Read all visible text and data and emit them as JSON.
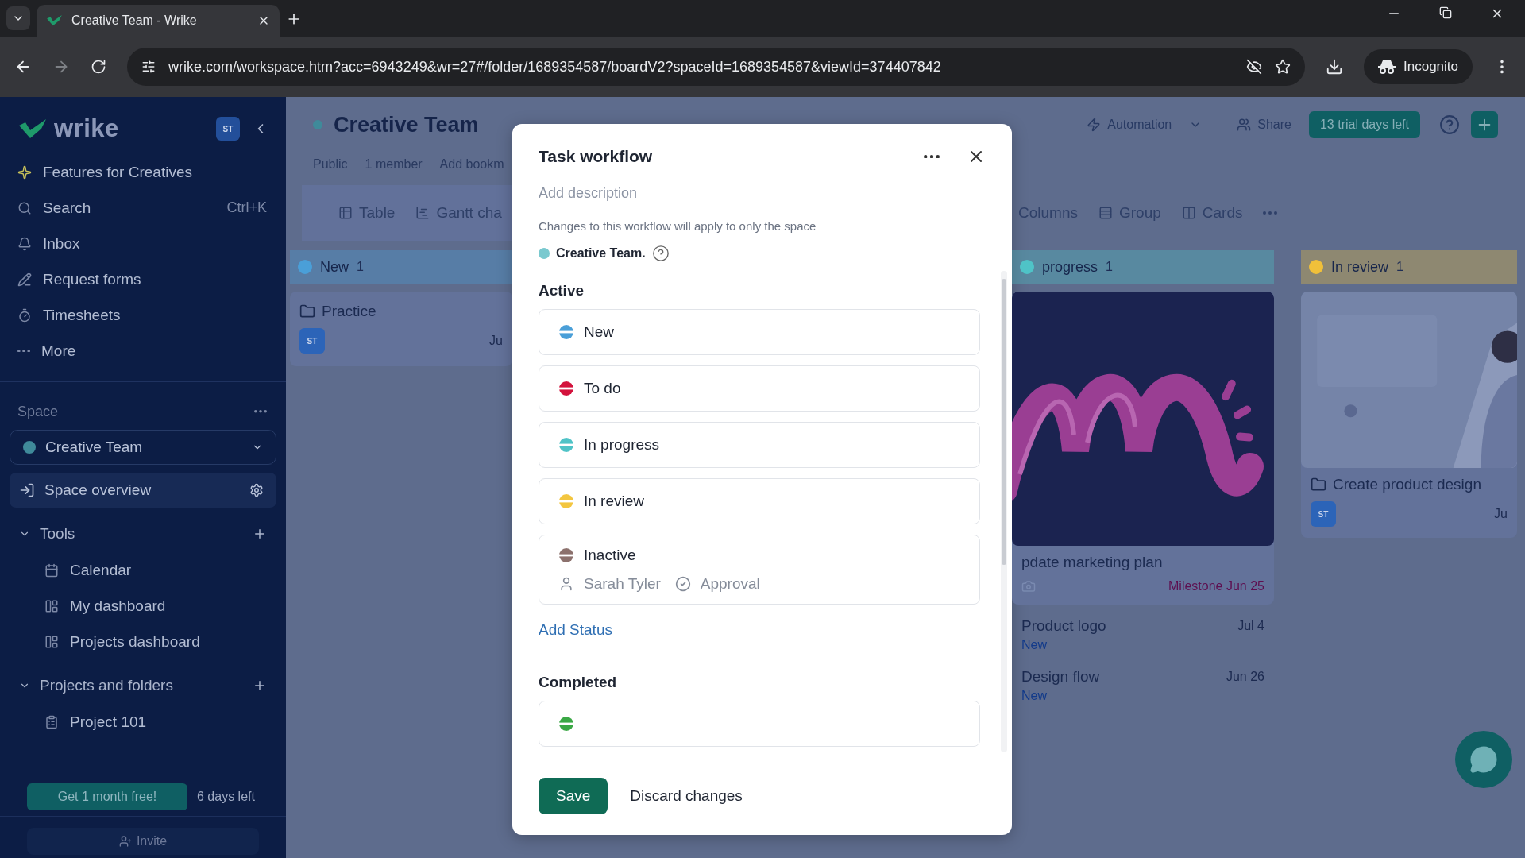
{
  "browser": {
    "tab_title": "Creative Team - Wrike",
    "url": "wrike.com/workspace.htm?acc=6943249&wr=27#/folder/1689354587/boardV2?spaceId=1689354587&viewId=374407842",
    "incognito": "Incognito"
  },
  "sidebar": {
    "logo": "wrike",
    "avatar": "ST",
    "nav": [
      {
        "label": "Features for Creatives"
      },
      {
        "label": "Search",
        "shortcut": "Ctrl+K"
      },
      {
        "label": "Inbox"
      },
      {
        "label": "Request forms"
      },
      {
        "label": "Timesheets"
      },
      {
        "label": "More"
      }
    ],
    "space_heading": "Space",
    "space_selector": "Creative Team",
    "space_overview": {
      "label": "Space overview",
      "selected": true
    },
    "sections": [
      {
        "title": "Tools",
        "expanded": true,
        "items": [
          {
            "label": "Calendar"
          },
          {
            "label": "My dashboard"
          },
          {
            "label": "Projects dashboard"
          }
        ]
      },
      {
        "title": "Projects and folders",
        "expanded": true,
        "items": [
          {
            "label": "Project 101"
          }
        ]
      }
    ],
    "promo_button": "Get 1 month free!",
    "promo_note": "6 days left",
    "invite": "Invite"
  },
  "header": {
    "title": "Creative Team",
    "meta": [
      "Public",
      "1 member",
      "Add bookm"
    ],
    "automation": "Automation",
    "share": "Share",
    "trial": "13 trial days left"
  },
  "views_left": [
    "Table",
    "Gantt cha"
  ],
  "views_right": [
    "Columns",
    "Group",
    "Cards"
  ],
  "board_left": [
    {
      "title": "New",
      "count": "1",
      "color": "#4a9fd8",
      "cards": [
        {
          "kind": "task",
          "title": "Practice",
          "avatar": "ST",
          "date": "Ju"
        }
      ]
    }
  ],
  "board_right": [
    {
      "title": "progress",
      "count": "1",
      "color": "#4fc3c7",
      "cards": [
        {
          "kind": "picture-task",
          "title": "pdate marketing plan",
          "tag": "Milestone Jun 25"
        },
        {
          "kind": "compact",
          "title": "Product logo",
          "date": "Jul 4",
          "status": "New"
        },
        {
          "kind": "compact",
          "title": "Design flow",
          "date": "Jun 26",
          "status": "New"
        }
      ]
    },
    {
      "title": "In review",
      "count": "1",
      "color": "#f0c03a",
      "cards": [
        {
          "kind": "picture-task",
          "title": "Create product design",
          "avatar": "ST",
          "date": "Ju"
        }
      ]
    }
  ],
  "modal": {
    "title": "Task workflow",
    "description_placeholder": "Add description",
    "note": "Changes to this workflow will apply to only the space",
    "space": "Creative Team.",
    "groups": [
      {
        "title": "Active",
        "statuses": [
          {
            "label": "New",
            "color": "#4a9fd8"
          },
          {
            "label": "To do",
            "color": "#d3123c"
          },
          {
            "label": "In progress",
            "color": "#4fc3c7"
          },
          {
            "label": "In review",
            "color": "#f3c640"
          },
          {
            "label": "Inactive",
            "color": "#8c716d",
            "assignee": "Sarah Tyler",
            "approval": "Approval"
          }
        ],
        "add": "Add Status"
      },
      {
        "title": "Completed",
        "statuses": [
          {
            "color": "#3aa845"
          }
        ]
      }
    ],
    "save": "Save",
    "discard": "Discard changes"
  }
}
